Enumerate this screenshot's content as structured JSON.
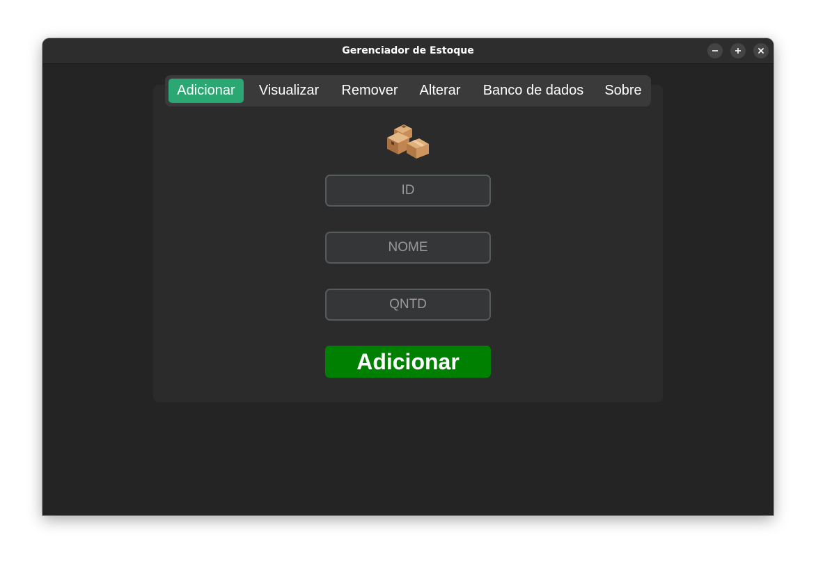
{
  "window": {
    "title": "Gerenciador de Estoque"
  },
  "tabs": [
    {
      "label": "Adicionar",
      "active": true
    },
    {
      "label": "Visualizar",
      "active": false
    },
    {
      "label": "Remover",
      "active": false
    },
    {
      "label": "Alterar",
      "active": false
    },
    {
      "label": "Banco de dados",
      "active": false
    },
    {
      "label": "Sobre",
      "active": false
    }
  ],
  "form": {
    "icon": "package-boxes-icon",
    "fields": {
      "id": {
        "placeholder": "ID",
        "value": ""
      },
      "nome": {
        "placeholder": "NOME",
        "value": ""
      },
      "qntd": {
        "placeholder": "QNTD",
        "value": ""
      }
    },
    "submit_label": "Adicionar"
  },
  "colors": {
    "window_bg": "#242424",
    "titlebar_bg": "#2d2d2d",
    "panel_bg": "#2b2b2b",
    "tabbar_bg": "#3a3a3a",
    "tab_active": "#2aa772",
    "field_bg": "#343638",
    "field_border": "#565b5e",
    "submit_bg": "#008000"
  }
}
